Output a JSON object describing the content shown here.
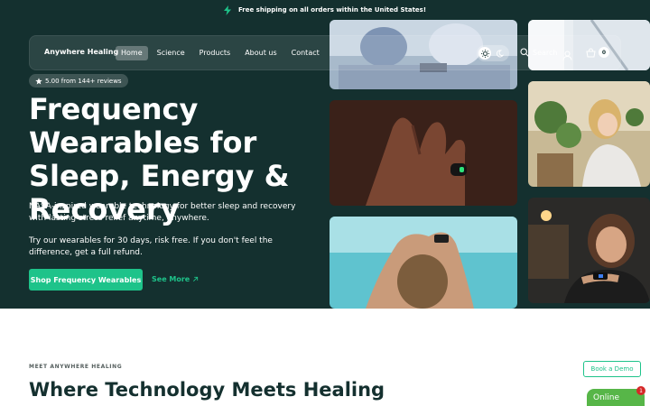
{
  "announcement": {
    "text": "Free shipping on all orders within the United States!",
    "icon": "lightning-icon"
  },
  "nav": {
    "logo": "Anywhere Healing",
    "items": [
      {
        "label": "Home",
        "active": true
      },
      {
        "label": "Science",
        "active": false
      },
      {
        "label": "Products",
        "active": false
      },
      {
        "label": "About us",
        "active": false
      },
      {
        "label": "Contact",
        "active": false
      }
    ],
    "search_label": "Search",
    "cart_count": "0"
  },
  "hero": {
    "rating": "5.00 from 144+ reviews",
    "headline": "Frequency Wearables for Sleep, Energy & Recovery",
    "description": "NASA-inspired wearable technology for better sleep and recovery with lasting stress relief anytime, anywhere.",
    "trial_text": "Try our wearables for 30 days, risk free. If you don't feel the difference, get a full refund.",
    "cta_label": "Shop Frequency Wearables",
    "see_more_label": "See More"
  },
  "section": {
    "eyebrow": "MEET ANYWHERE HEALING",
    "title": "Where Technology Meets Healing",
    "demo_label": "Book a Demo"
  },
  "chat": {
    "label": "Online",
    "badge": "1"
  },
  "colors": {
    "brand_dark": "#14302f",
    "accent": "#1ec38a",
    "chat_green": "#57b648"
  }
}
